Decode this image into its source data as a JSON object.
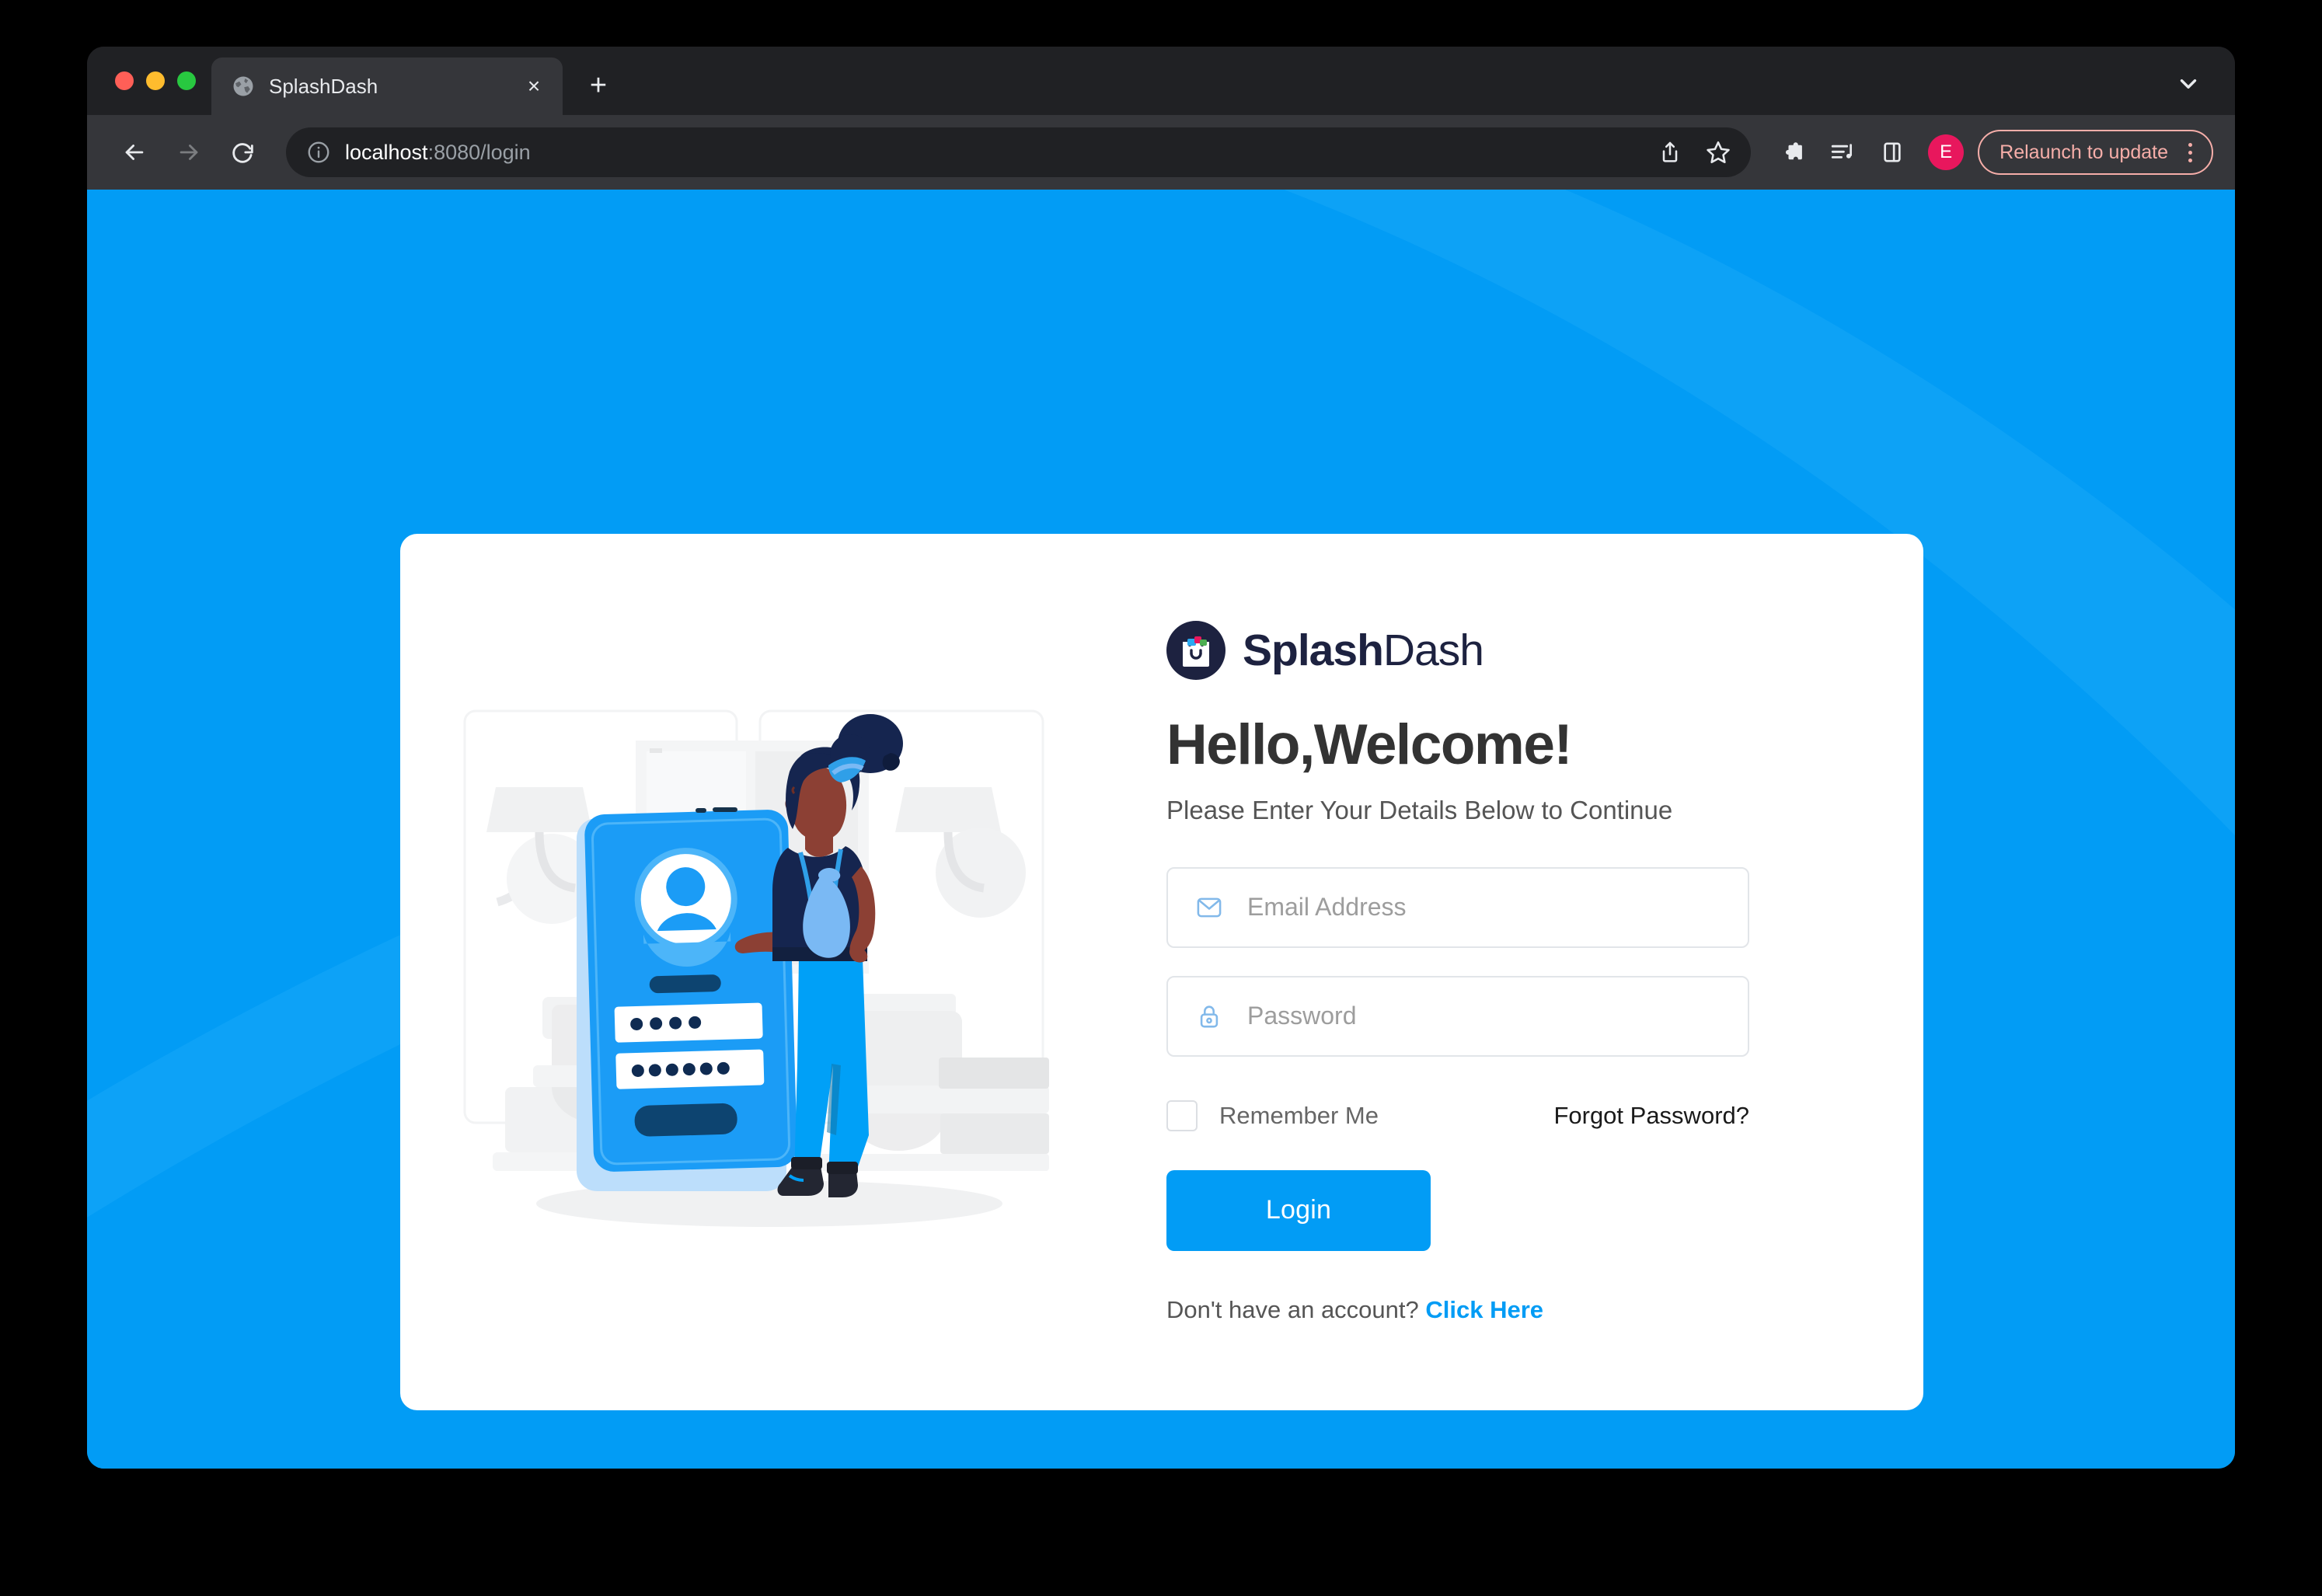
{
  "browser": {
    "tab": {
      "title": "SplashDash",
      "favicon": "globe-icon",
      "close_label": "×"
    },
    "new_tab_label": "+",
    "toolbar": {
      "back_icon": "arrow-left-icon",
      "forward_icon": "arrow-right-icon",
      "reload_icon": "reload-icon",
      "url_host": "localhost",
      "url_rest": ":8080/login",
      "url_full": "localhost:8080/login",
      "share_icon": "share-icon",
      "bookmark_icon": "star-icon",
      "extensions_icon": "puzzle-icon",
      "media_icon": "media-list-icon",
      "sidepanel_icon": "side-panel-icon",
      "profile_initial": "E",
      "relaunch_label": "Relaunch to update",
      "menu_icon": "kebab-menu-icon"
    }
  },
  "page": {
    "background_color": "#029cf5",
    "accent_color": "#029cf5",
    "brand": {
      "logo_icon": "shopping-bag-logo-icon",
      "name_bold": "Splash",
      "name_light": "Dash"
    },
    "headline": "Hello,Welcome!",
    "subhead": "Please Enter Your Details Below to Continue",
    "fields": {
      "email": {
        "icon": "envelope-icon",
        "placeholder": "Email Address",
        "value": ""
      },
      "password": {
        "icon": "lock-icon",
        "placeholder": "Password",
        "value": ""
      }
    },
    "remember_me_label": "Remember Me",
    "remember_me_checked": false,
    "forgot_password_label": "Forgot Password?",
    "login_button_label": "Login",
    "signup_prompt": "Don't have an account?",
    "signup_link_label": "Click Here",
    "illustration": {
      "name": "woman-with-login-phone-illustration",
      "alt": "Woman standing beside a large smartphone showing a login screen"
    }
  }
}
